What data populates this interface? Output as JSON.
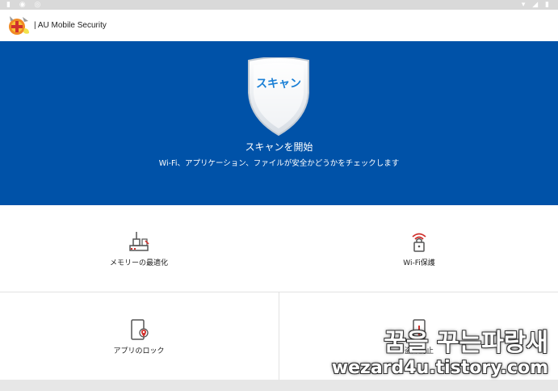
{
  "app": {
    "title": "| AU Mobile Security"
  },
  "hero": {
    "scan_button_label": "スキャン",
    "title": "スキャンを開始",
    "subtitle": "Wi-Fi、アプリケーション、ファイルが安全かどうかをチェックします"
  },
  "tiles": [
    {
      "label": "メモリーの最適化",
      "icon": "memory-optimize-icon"
    },
    {
      "label": "Wi-Fi保護",
      "icon": "wifi-lock-icon"
    },
    {
      "label": "アプリのロック",
      "icon": "app-lock-icon"
    },
    {
      "label": "盗難防止",
      "icon": "anti-theft-icon"
    }
  ],
  "watermark": {
    "line1": "꿈을 꾸는파랑새",
    "line2": "wezard4u.tistory.com"
  },
  "colors": {
    "hero_bg": "#0052a8",
    "accent": "#1a7fd6",
    "icon_red": "#d0312d"
  }
}
